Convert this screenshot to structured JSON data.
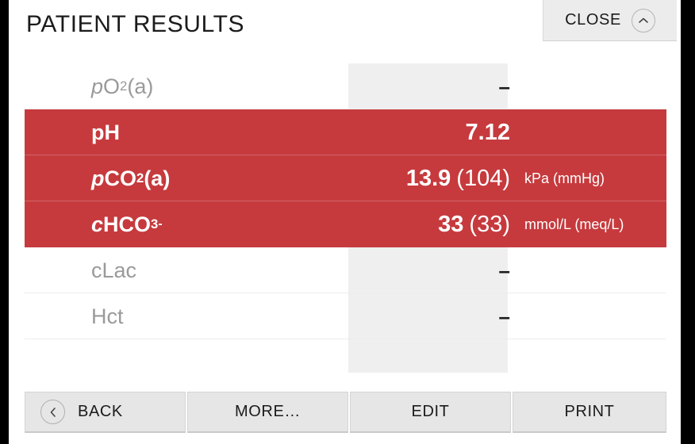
{
  "header": {
    "title": "PATIENT RESULTS",
    "close_label": "CLOSE",
    "close_icon": "chevron-up-icon"
  },
  "colors": {
    "highlight_red": "#C63A3D",
    "value_column_bg": "#EFEFEF",
    "inactive_text": "#9A9A9A",
    "button_face": "#E6E6E6",
    "frame": "#000000"
  },
  "results": {
    "rows": [
      {
        "id": "po2a",
        "label_parts": {
          "prefix_italic": "p",
          "base": "O",
          "sub": "2",
          "suffix": "(a)"
        },
        "label_plain": "pO2(a)",
        "value": "–",
        "secondary": "",
        "unit": "",
        "highlighted": false
      },
      {
        "id": "ph",
        "label_parts": {
          "prefix_italic": "",
          "base": "pH",
          "sub": "",
          "suffix": ""
        },
        "label_plain": "pH",
        "value": "7.12",
        "secondary": "",
        "unit": "",
        "highlighted": true
      },
      {
        "id": "pco2a",
        "label_parts": {
          "prefix_italic": "p",
          "base": "CO",
          "sub": "2",
          "suffix": "(a)"
        },
        "label_plain": "pCO2(a)",
        "value": "13.9",
        "secondary": "(104)",
        "unit": "kPa (mmHg)",
        "highlighted": true
      },
      {
        "id": "chco3",
        "label_parts": {
          "prefix_italic": "c",
          "base": "HCO",
          "sub": "3",
          "sup": "-",
          "suffix": ""
        },
        "label_plain": "cHCO3-",
        "value": "33",
        "secondary": "(33)",
        "unit": "mmol/L (meq/L)",
        "highlighted": true
      },
      {
        "id": "clac",
        "label_parts": {
          "prefix_italic": "",
          "base": "cLac",
          "sub": "",
          "suffix": ""
        },
        "label_plain": "cLac",
        "value": "–",
        "secondary": "",
        "unit": "",
        "highlighted": false
      },
      {
        "id": "hct",
        "label_parts": {
          "prefix_italic": "",
          "base": "Hct",
          "sub": "",
          "suffix": ""
        },
        "label_plain": "Hct",
        "value": "–",
        "secondary": "",
        "unit": "",
        "highlighted": false
      }
    ]
  },
  "actions": {
    "back": {
      "label": "BACK",
      "icon": "chevron-left-icon"
    },
    "more": {
      "label": "MORE…"
    },
    "edit": {
      "label": "EDIT"
    },
    "print": {
      "label": "PRINT"
    }
  }
}
